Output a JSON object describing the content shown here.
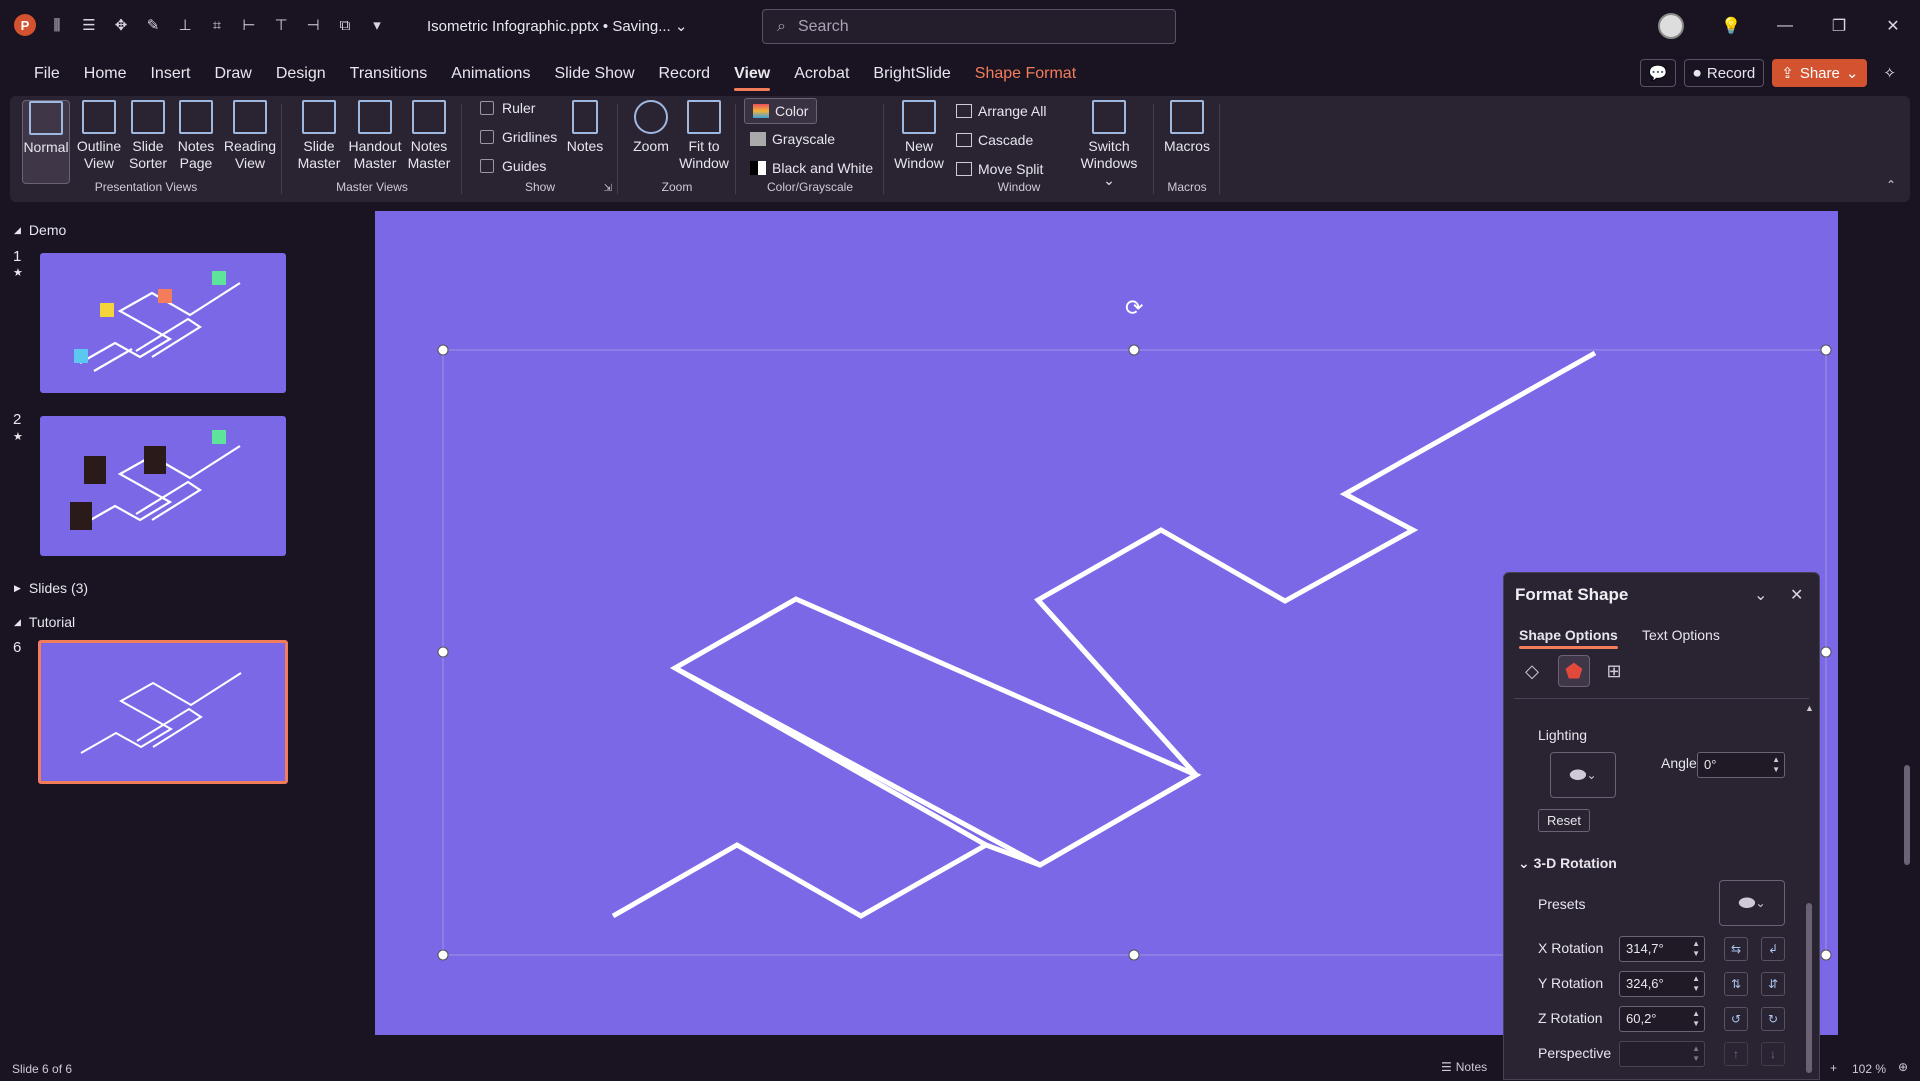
{
  "app": {
    "document_title": "Isometric Infographic.pptx • Saving...",
    "search_placeholder": "Search"
  },
  "menu": {
    "tabs": [
      "File",
      "Home",
      "Insert",
      "Draw",
      "Design",
      "Transitions",
      "Animations",
      "Slide Show",
      "Record",
      "View",
      "Acrobat",
      "BrightSlide",
      "Shape Format"
    ],
    "active_tab": "View",
    "contextual_tab": "Shape Format",
    "record_label": "Record",
    "share_label": "Share"
  },
  "ribbon": {
    "presentation_views": {
      "label": "Presentation Views",
      "buttons": [
        {
          "l1": "Normal",
          "l2": ""
        },
        {
          "l1": "Outline",
          "l2": "View"
        },
        {
          "l1": "Slide",
          "l2": "Sorter"
        },
        {
          "l1": "Notes",
          "l2": "Page"
        },
        {
          "l1": "Reading",
          "l2": "View"
        }
      ]
    },
    "master_views": {
      "label": "Master Views",
      "buttons": [
        {
          "l1": "Slide",
          "l2": "Master"
        },
        {
          "l1": "Handout",
          "l2": "Master"
        },
        {
          "l1": "Notes",
          "l2": "Master"
        }
      ]
    },
    "show": {
      "label": "Show",
      "ruler": "Ruler",
      "gridlines": "Gridlines",
      "guides": "Guides",
      "notes": "Notes"
    },
    "zoom": {
      "label": "Zoom",
      "zoom": "Zoom",
      "fit_l1": "Fit to",
      "fit_l2": "Window"
    },
    "color_grayscale": {
      "label": "Color/Grayscale",
      "color": "Color",
      "grayscale": "Grayscale",
      "bw": "Black and White"
    },
    "window": {
      "label": "Window",
      "new_l1": "New",
      "new_l2": "Window",
      "arrange_all": "Arrange All",
      "cascade": "Cascade",
      "move_split": "Move Split",
      "switch_l1": "Switch",
      "switch_l2": "Windows"
    },
    "macros": {
      "label": "Macros",
      "macros": "Macros"
    }
  },
  "slides_panel": {
    "sections": [
      {
        "name": "Demo"
      },
      {
        "name": "Slides (3)"
      },
      {
        "name": "Tutorial"
      }
    ],
    "slide_numbers": [
      "1",
      "2",
      "6"
    ]
  },
  "format_shape": {
    "title": "Format Shape",
    "tabs": [
      "Shape Options",
      "Text Options"
    ],
    "lighting_label": "Lighting",
    "angle_label": "Angle",
    "angle_value": "0°",
    "reset_label": "Reset",
    "rotation_header": "3-D Rotation",
    "presets_label": "Presets",
    "x_rotation_label": "X Rotation",
    "x_rotation_value": "314,7°",
    "y_rotation_label": "Y Rotation",
    "y_rotation_value": "324,6°",
    "z_rotation_label": "Z Rotation",
    "z_rotation_value": "60,2°",
    "perspective_label": "Perspective"
  },
  "status": {
    "slide_info": "Slide 6 of 6",
    "notes_label": "Notes",
    "zoom_level": "102 %"
  },
  "colors": {
    "slide_bg": "#7b68e6",
    "accent": "#f37c5a",
    "app_bg": "#1a1422"
  }
}
